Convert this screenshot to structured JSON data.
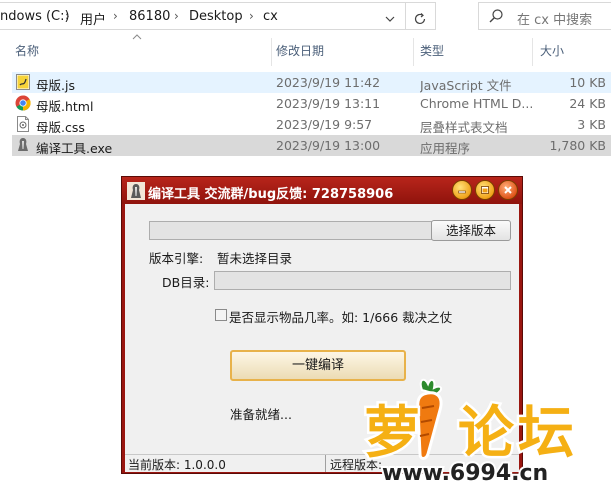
{
  "address": {
    "crumbs": [
      "ndows (C:)",
      "用户",
      "86180",
      "Desktop",
      "cx"
    ],
    "search_placeholder": "在 cx 中搜索"
  },
  "columns": {
    "name": "名称",
    "modified": "修改日期",
    "type": "类型",
    "size": "大小"
  },
  "files": [
    {
      "name": "母版.js",
      "modified": "2023/9/19 11:42",
      "type": "JavaScript 文件",
      "size": "10 KB",
      "icon": "js-file-icon"
    },
    {
      "name": "母版.html",
      "modified": "2023/9/19 13:11",
      "type": "Chrome HTML D...",
      "size": "24 KB",
      "icon": "chrome-icon"
    },
    {
      "name": "母版.css",
      "modified": "2023/9/19 9:57",
      "type": "层叠样式表文档",
      "size": "3 KB",
      "icon": "css-file-icon"
    },
    {
      "name": "编译工具.exe",
      "modified": "2023/9/19 13:00",
      "type": "应用程序",
      "size": "1,780 KB",
      "icon": "exe-app-icon"
    }
  ],
  "dialog": {
    "title": "编译工具 交流群/bug反馈: 728758906",
    "choose_version_label": "选择版本",
    "version_engine_label": "版本引擎:",
    "version_engine_value": "暂未选择目录",
    "db_label": "DB目录:",
    "show_rate_label": "是否显示物品几率。如: 1/666 裁决之仗",
    "compile_label": "一键编译",
    "status_message": "准备就绪...",
    "current_version": "当前版本: 1.0.0.0",
    "remote_version": "远程版本:"
  },
  "watermark": {
    "brand": "萝卜论坛",
    "domain": "www.6994.cn"
  },
  "colors": {
    "titlebar": "#a81c14",
    "selection_light": "#e5f3ff",
    "selection_gray": "#d9d9d9",
    "compile_border": "#e8b24a"
  }
}
